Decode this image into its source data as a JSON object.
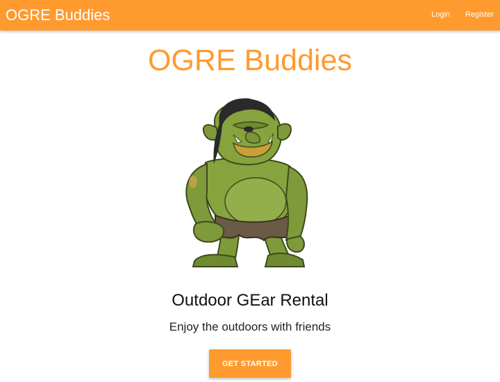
{
  "navbar": {
    "brand": "OGRE Buddies",
    "links": [
      {
        "label": "Login"
      },
      {
        "label": "Register"
      }
    ]
  },
  "hero": {
    "title": "OGRE Buddies",
    "tagline": "Outdoor GEar Rental",
    "subtitle": "Enjoy the outdoors with friends",
    "cta_label": "GET STARTED",
    "image_subject": "green ogre cartoon"
  },
  "colors": {
    "accent": "#ff9a2e",
    "background": "#ffffff",
    "ogre_skin": "#7f9a3a",
    "ogre_hair": "#2a2a2a",
    "loincloth": "#6b5a45"
  }
}
